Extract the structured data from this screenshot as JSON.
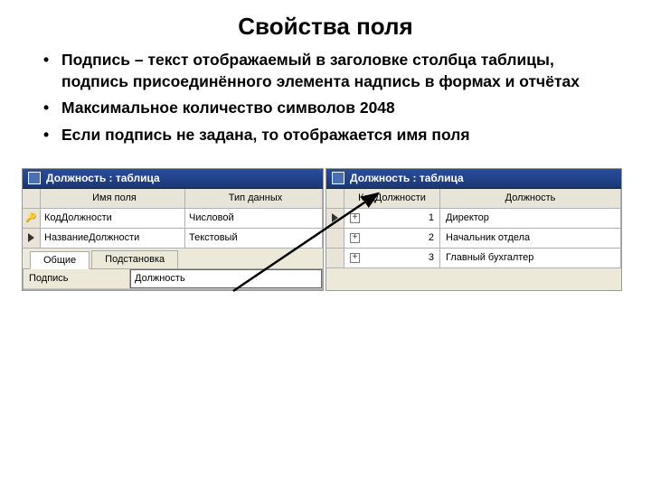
{
  "title": "Свойства поля",
  "bullets": [
    "Подпись – текст отображаемый в заголовке столбца таблицы, подпись присоединённого элемента надпись в формах и отчётах",
    "Максимальное количество символов 2048",
    "Если подпись не задана, то отображается имя поля"
  ],
  "left": {
    "winTitle": "Должность : таблица",
    "headers": {
      "field": "Имя поля",
      "type": "Тип данных"
    },
    "rows": [
      {
        "key": true,
        "selected": false,
        "name": "КодДолжности",
        "type": "Числовой"
      },
      {
        "key": false,
        "selected": true,
        "name": "НазваниеДолжности",
        "type": "Текстовый"
      }
    ],
    "tabs": {
      "general": "Общие",
      "lookup": "Подстановка"
    },
    "prop": {
      "label": "Подпись",
      "value": "Должность"
    }
  },
  "right": {
    "winTitle": "Должность : таблица",
    "headers": {
      "c1": "КодДолжности",
      "c2": "Должность"
    },
    "rows": [
      {
        "current": true,
        "id": "1",
        "name": "Директор"
      },
      {
        "current": false,
        "id": "2",
        "name": "Начальник отдела"
      },
      {
        "current": false,
        "id": "3",
        "name": "Главный бухгалтер"
      }
    ]
  }
}
